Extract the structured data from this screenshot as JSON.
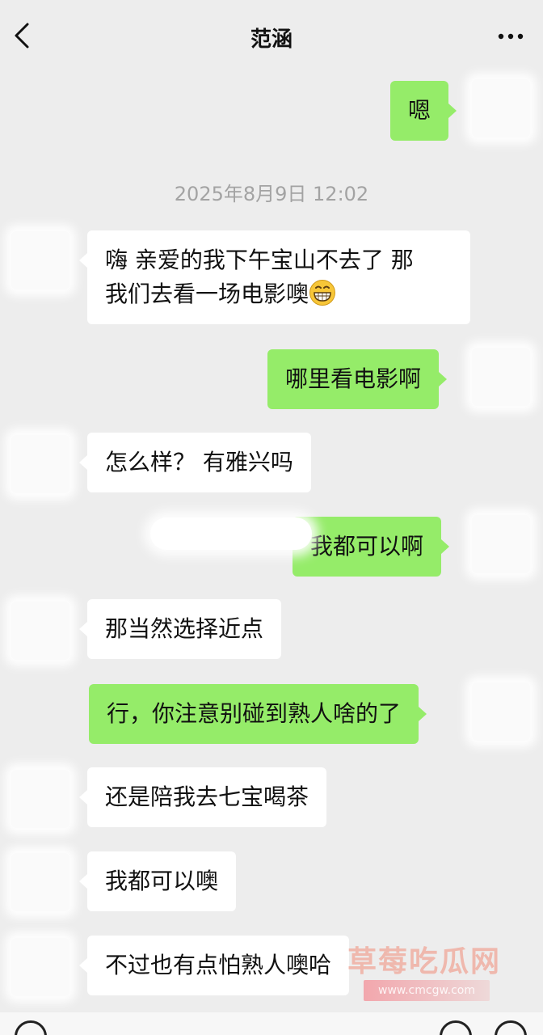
{
  "header": {
    "title": "范涵"
  },
  "timestamp": "2025年8月9日 12:02",
  "messages": [
    {
      "side": "right",
      "text": "嗯"
    },
    {
      "side": "left",
      "line1": "嗨 亲爱的我下午宝山不去了  那",
      "line2": "我们去看一场电影噢",
      "emoji": "grinning-face-emoji"
    },
    {
      "side": "right",
      "text": "哪里看电影啊"
    },
    {
      "side": "left",
      "text": "怎么样？  有雅兴吗"
    },
    {
      "side": "right",
      "text": "我都可以啊"
    },
    {
      "side": "left",
      "text": "那当然选择近点"
    },
    {
      "side": "right",
      "text": "行，你注意别碰到熟人啥的了"
    },
    {
      "side": "left",
      "text": "还是陪我去七宝喝茶"
    },
    {
      "side": "left",
      "text": "我都可以噢"
    },
    {
      "side": "left",
      "text": "不过也有点怕熟人噢哈"
    }
  ],
  "watermark": {
    "text": "草莓吃瓜网",
    "url": "www.cmcgw.com"
  },
  "colors": {
    "background": "#ededed",
    "outgoing_bubble": "#95ec69",
    "incoming_bubble": "#ffffff",
    "timestamp": "#a3a3a3"
  },
  "icons": {
    "back": "back-chevron-icon",
    "more": "more-dots-icon",
    "voice": "voice-icon",
    "emoji": "emoji-icon",
    "add": "add-icon"
  }
}
